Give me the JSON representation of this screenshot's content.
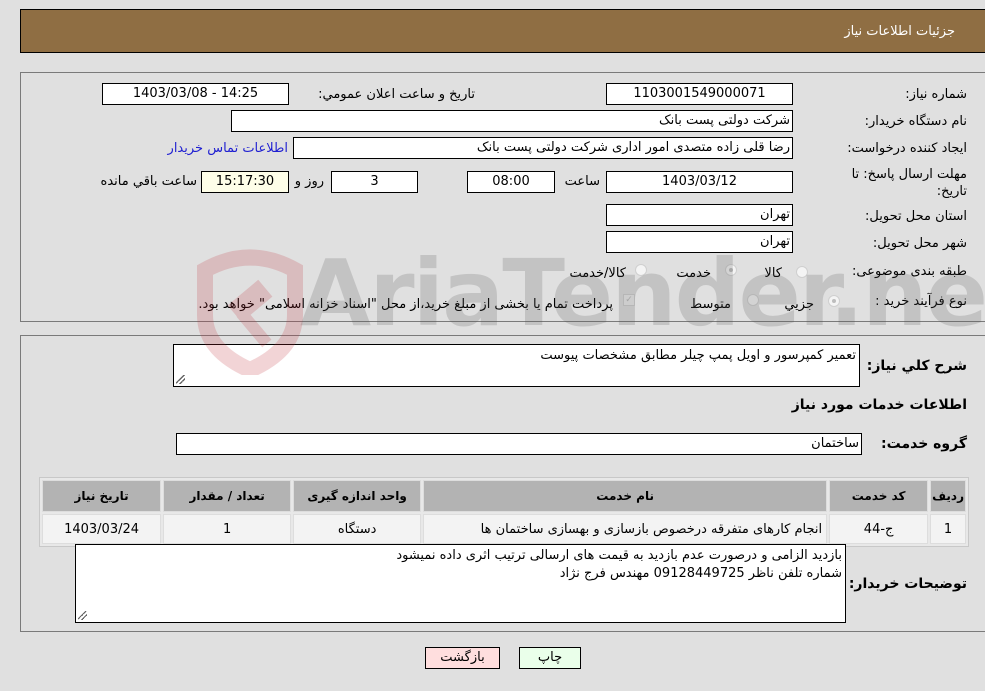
{
  "header": {
    "title": "جزئیات اطلاعات نیاز"
  },
  "info": {
    "need_number_label": "شماره نیاز:",
    "need_number": "1103001549000071",
    "announce_label": "تاریخ و ساعت اعلان عمومي:",
    "announce_value": "1403/03/08 - 14:25",
    "buyer_org_label": "نام دستگاه خریدار:",
    "buyer_org": "شرکت دولتی پست بانک",
    "creator_label": "ایجاد کننده درخواست:",
    "creator": "رضا قلی زاده متصدی امور اداری شرکت دولتی پست بانک",
    "buyer_contact_link": "اطلاعات تماس خریدار",
    "deadline_label_line1": "مهلت ارسال پاسخ: تا",
    "deadline_label_line2": "تاریخ:",
    "deadline_date": "1403/03/12",
    "time_label": "ساعت",
    "deadline_time": "08:00",
    "days_value": "3",
    "days_label": "روز و",
    "remaining_time": "15:17:30",
    "remaining_label": "ساعت باقي مانده",
    "province_label": "استان محل تحویل:",
    "province": "تهران",
    "city_label": "شهر محل تحویل:",
    "city": "تهران",
    "category_label": "طبقه بندی موضوعی:",
    "category_options": [
      "کالا",
      "خدمت",
      "کالا/خدمت"
    ],
    "category_selected": "خدمت",
    "process_label": "نوع فرآیند خرید :",
    "process_options": [
      "جزيي",
      "متوسط"
    ],
    "process_selected": "جزيي",
    "treasury_note": "پرداخت تمام یا بخشی از مبلغ خرید،از محل \"اسناد خزانه اسلامی\" خواهد بود."
  },
  "details": {
    "summary_label": "شرح کلي نياز:",
    "summary": "تعمیر کمپرسور و اویل پمپ چیلر مطابق مشخصات پیوست",
    "services_heading": "اطلاعات خدمات مورد نياز",
    "service_group_label": "گروه خدمت:",
    "service_group": "ساختمان",
    "table": {
      "headers": [
        "ردیف",
        "کد خدمت",
        "نام خدمت",
        "واحد اندازه گیری",
        "تعداد / مقدار",
        "تاریخ نیاز"
      ],
      "rows": [
        [
          "1",
          "ج-44",
          "انجام کارهای متفرقه درخصوص بازسازی و بهسازی ساختمان ها",
          "دستگاه",
          "1",
          "1403/03/24"
        ]
      ]
    },
    "buyer_notes_label": "توضيحات خريدار:",
    "buyer_notes_line1": "بازدید الزامی و درصورت عدم بازدید به قیمت های ارسالی ترتیب اثری داده نمیشود",
    "buyer_notes_line2": "شماره تلفن ناظر 09128449725 مهندس فرج نژاد"
  },
  "buttons": {
    "print": "چاپ",
    "back": "بازگشت"
  },
  "watermark": {
    "text": "AriaTender.neT"
  },
  "colors": {
    "header_bg": "#8f6e43",
    "link": "#1f1fd1",
    "print_bg": "#eaffea",
    "back_bg": "#ffdede"
  }
}
